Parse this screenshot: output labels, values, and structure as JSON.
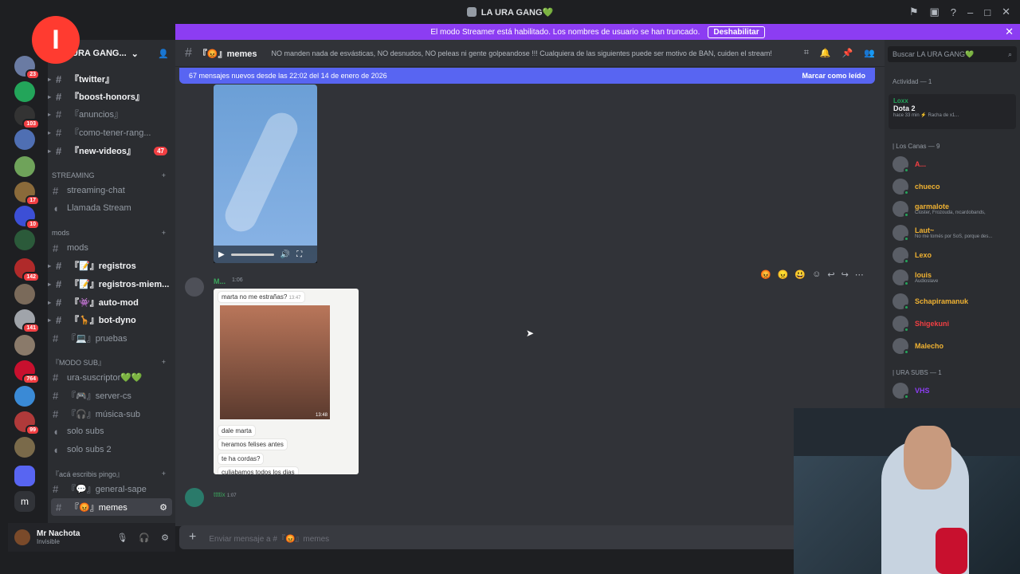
{
  "app": {
    "title": "LA URA GANG💚"
  },
  "streamer_bar": {
    "text": "El modo Streamer está habilitado. Los nombres de usuario se han truncado.",
    "button": "Deshabilitar"
  },
  "guilds": [
    {
      "badge": "23"
    },
    {
      "badge": ""
    },
    {
      "badge": "103"
    },
    {
      "badge": ""
    },
    {
      "badge": ""
    },
    {
      "badge": "17"
    },
    {
      "badge": "10"
    },
    {
      "badge": ""
    },
    {
      "badge": "142"
    },
    {
      "badge": ""
    },
    {
      "badge": "141"
    },
    {
      "badge": ""
    },
    {
      "badge": "764"
    },
    {
      "badge": ""
    },
    {
      "badge": "99"
    },
    {
      "badge": ""
    }
  ],
  "server": {
    "name": "URA GANG..."
  },
  "channels": [
    {
      "name": "『twitter』",
      "bright": true
    },
    {
      "name": "『boost-honors』",
      "bright": true
    },
    {
      "name": "『anuncios』",
      "bright": false
    },
    {
      "name": "『como-tener-rang...",
      "bright": false
    },
    {
      "name": "『new-videos』",
      "bright": true,
      "badge": "47"
    }
  ],
  "streaming_category": "STREAMING",
  "streaming_channels": [
    "streaming-chat",
    "Llamada Stream"
  ],
  "mods_category": "mods",
  "mods_channels": [
    {
      "name": "mods",
      "bright": false
    },
    {
      "name": "『📝』registros",
      "bright": true
    },
    {
      "name": "『📝』registros-miem...",
      "bright": true
    },
    {
      "name": "『👾』auto-mod",
      "bright": true
    },
    {
      "name": "『🦒』bot-dyno",
      "bright": true
    },
    {
      "name": "『💻』pruebas",
      "bright": false
    }
  ],
  "sub_category": "『MODO SUB』",
  "sub_channels": [
    "ura-suscriptor💚💚",
    "『🎮』server-cs",
    "『🎧』música-sub",
    "solo subs",
    "solo subs 2"
  ],
  "chat_category": "『acá escribis pingo』",
  "chat_channels": [
    {
      "name": "『💬』general-sape"
    },
    {
      "name": "『😡』memes"
    }
  ],
  "user": {
    "name": "Mr Nachota",
    "status": "Invisible"
  },
  "channel_header": {
    "name": "『😡』memes",
    "topic": "NO manden nada de esvásticas, NO desnudos, NO peleas ni gente golpeandose !!! Cualquiera de las siguientes puede ser motivo de BAN, cuiden el stream!"
  },
  "new_messages_bar": {
    "text": "67 mensajes nuevos desde las 22:02 del 14 de enero de 2026",
    "mark_read": "Marcar como leído"
  },
  "message": {
    "author": "M...",
    "time": "1:06",
    "image_lines": {
      "q1": "marta no me estrañas?",
      "t1": "13:47",
      "photo_time": "13:48",
      "l1": "dale marta",
      "l2": "heramos felises antes",
      "l3": "te ha cordas?",
      "l4": "culiabamos todos los dias"
    }
  },
  "next_message": {
    "author": "ttttix",
    "time": "1:07"
  },
  "composer": {
    "placeholder": "Enviar mensaje a #『😡』memes"
  },
  "search": {
    "placeholder": "Buscar LA URA GANG💚"
  },
  "members": {
    "activity_header": "Actividad — 1",
    "activity": {
      "user": "Loxx",
      "game": "Dota 2",
      "detail": "hace 33 min  ⚡ Racha de x1..."
    },
    "role1": "| Los Canas — 9",
    "list1": [
      {
        "name": "A...",
        "color": "#f23f43",
        "sub": ""
      },
      {
        "name": "chueco",
        "color": "#f0b232",
        "sub": ""
      },
      {
        "name": "garmalote",
        "color": "#f0b232",
        "sub": "Clúster, Frozouda, rxcardobands,"
      },
      {
        "name": "Laut~",
        "color": "#f0b232",
        "sub": "No me tomés por SoS, porque des..."
      },
      {
        "name": "Lexo",
        "color": "#f0b232",
        "sub": ""
      },
      {
        "name": "louis",
        "color": "#f0b232",
        "sub": "Audioslave"
      },
      {
        "name": "Schapiramanuk",
        "color": "#f0b232",
        "sub": ""
      },
      {
        "name": "Shigekuni",
        "color": "#f23f43",
        "sub": ""
      },
      {
        "name": "Malecho",
        "color": "#f0b232",
        "sub": ""
      }
    ],
    "role2": "| URA SUBS — 1",
    "list2": [
      {
        "name": "VHS",
        "color": "#8c3df2",
        "sub": ""
      }
    ]
  },
  "colors": {
    "accent": "#5865f2",
    "streamer": "#8c3df2",
    "online": "#23a55a"
  }
}
